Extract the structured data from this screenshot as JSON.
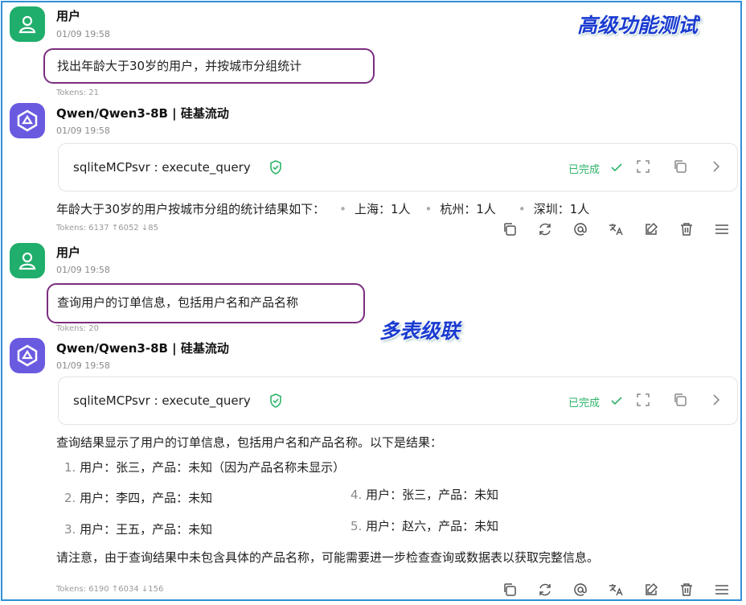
{
  "colors": {
    "user_avatar": "#1fae6b",
    "model_avatar": "#6a5ae0",
    "highlight_outline": "#7b2d7f",
    "annotation": "#1a3bd0",
    "done": "#2fb36a",
    "frame": "#2f8fd8"
  },
  "annotations": {
    "top_right": "高级功能测试",
    "middle": "多表级联"
  },
  "messages": [
    {
      "role": "user",
      "name": "用户",
      "time": "01/09 19:58",
      "text": "找出年龄大于30岁的用户，并按城市分组统计",
      "tokens": "Tokens: 21"
    },
    {
      "role": "assistant",
      "name": "Qwen/Qwen3-8B | 硅基流动",
      "time": "01/09 19:58",
      "tool": {
        "name": "sqliteMCPsvr : execute_query",
        "status": "已完成"
      },
      "text": "年龄大于30岁的用户按城市分组的统计结果如下：",
      "bullets": [
        "上海：1人",
        "杭州：1人",
        "深圳：1人"
      ],
      "tokens": "Tokens: 6137 ↑6052 ↓85"
    },
    {
      "role": "user",
      "name": "用户",
      "time": "01/09 19:58",
      "text": "查询用户的订单信息，包括用户名和产品名称",
      "tokens": "Tokens: 20"
    },
    {
      "role": "assistant",
      "name": "Qwen/Qwen3-8B | 硅基流动",
      "time": "01/09 19:58",
      "tool": {
        "name": "sqliteMCPsvr : execute_query",
        "status": "已完成"
      },
      "text": "查询结果显示了用户的订单信息，包括用户名和产品名称。以下是结果：",
      "list": [
        {
          "num": "1.",
          "text": "用户：张三，产品：未知（因为产品名称未显示）"
        },
        {
          "num": "2.",
          "text": "用户：李四，产品：未知"
        },
        {
          "num": "3.",
          "text": "用户：王五，产品：未知"
        },
        {
          "num": "4.",
          "text": "用户：张三，产品：未知"
        },
        {
          "num": "5.",
          "text": "用户：赵六，产品：未知"
        }
      ],
      "note": "请注意，由于查询结果中未包含具体的产品名称，可能需要进一步检查查询或数据表以获取完整信息。",
      "tokens": "Tokens: 6190 ↑6034 ↓156"
    }
  ],
  "toolbar_icons": [
    "copy-icon",
    "regenerate-icon",
    "mention-icon",
    "translate-icon",
    "edit-icon",
    "delete-icon",
    "menu-icon"
  ]
}
